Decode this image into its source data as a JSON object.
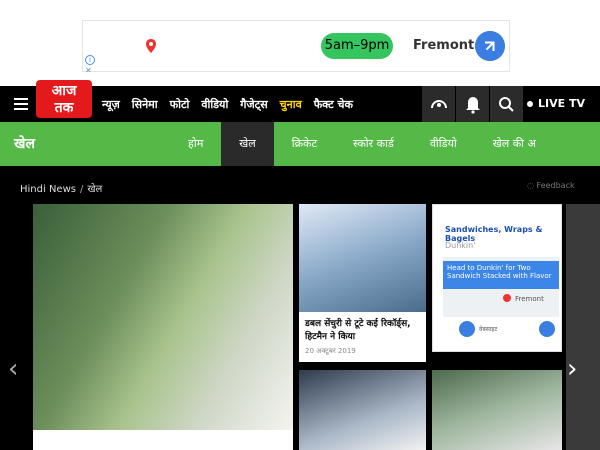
{
  "ad": {
    "hours": "5am–9pm",
    "city": "Fremont",
    "info_icon": "info-icon",
    "close_icon": "close-icon"
  },
  "logo": {
    "line1": "आज",
    "line2": "तक"
  },
  "nav": {
    "items": [
      "न्यूज़",
      "सिनेमा",
      "फोटो",
      "वीडियो",
      "गैजेट्स",
      "चुनाव",
      "फैक्ट चेक"
    ],
    "highlight_item": "चुनाव",
    "live_label": "LIVE TV",
    "icons": [
      "podcast-icon",
      "bell-icon",
      "search-icon"
    ]
  },
  "section": {
    "title": "खेल",
    "tabs": [
      "होम",
      "खेल",
      "क्रिकेट",
      "स्कोर कार्ड",
      "वीडियो",
      "खेल की अ"
    ],
    "active_tab": "खेल"
  },
  "breadcrumb": {
    "root": "Hindi News",
    "current": "खेल"
  },
  "feedback": "Feedback",
  "cards": {
    "small_title": "डबल सेंचुरी से टूटे कई रिकॉर्ड्स, हिटमैन ने किया",
    "small_date": "20 अक्टूबर 2019"
  },
  "ad_card": {
    "title": "Sandwiches, Wraps & Bagels",
    "brand": "Dunkin'",
    "banner": "Head to Dunkin' for Two Sandwich Stacked with Flavor",
    "map_city": "Fremont",
    "bottom_label": "वेबसाइट"
  },
  "colors": {
    "brand_red": "#e3191c",
    "section_green": "#55b947",
    "highlight_yellow": "#ffd400"
  }
}
